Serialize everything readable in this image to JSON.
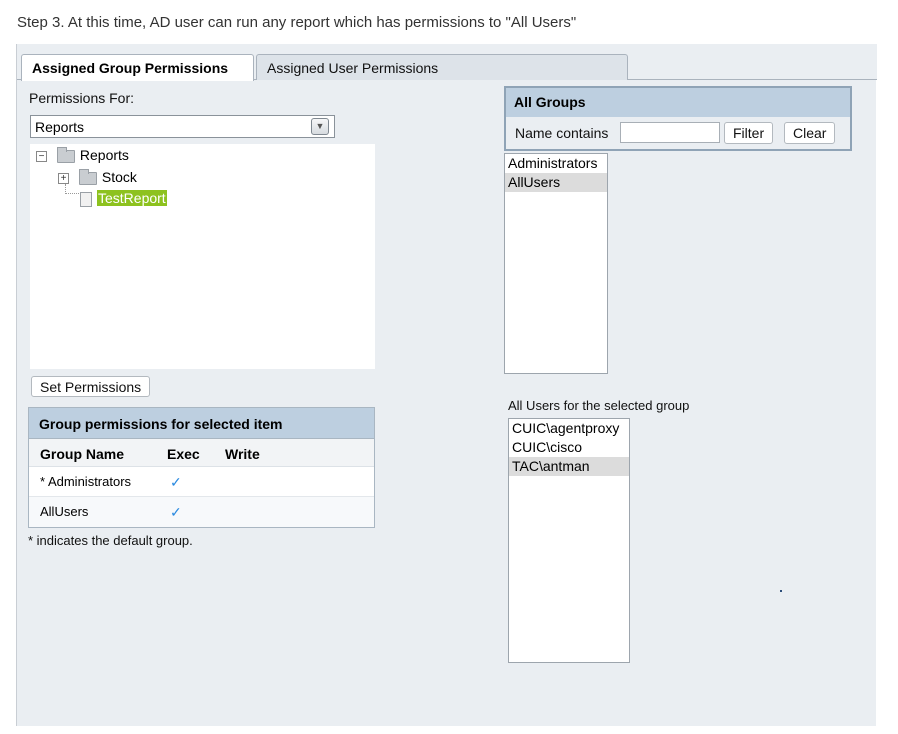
{
  "caption": "Step 3. At this time, AD user can run any report which has permissions to \"All Users\"",
  "tabs": [
    {
      "label": "Assigned Group Permissions",
      "active": true
    },
    {
      "label": "Assigned User Permissions",
      "active": false
    }
  ],
  "left": {
    "permissions_for_label": "Permissions For:",
    "select_value": "Reports",
    "tree": {
      "root": {
        "label": "Reports",
        "expander": "−",
        "icon": "folder-open-icon"
      },
      "children": [
        {
          "label": "Stock",
          "expander": "+",
          "icon": "folder-icon"
        },
        {
          "label": "TestReport",
          "icon": "report-icon",
          "selected": true
        }
      ]
    },
    "set_permissions_label": "Set Permissions",
    "group_table": {
      "title": "Group permissions for selected item",
      "columns": [
        "Group Name",
        "Exec",
        "Write"
      ],
      "rows": [
        {
          "group": "* Administrators",
          "exec": "✓",
          "write": ""
        },
        {
          "group": "AllUsers",
          "exec": "✓",
          "write": ""
        }
      ]
    },
    "footnote": "* indicates the default group."
  },
  "right": {
    "all_groups_title": "All Groups",
    "name_contains_label": "Name contains",
    "name_contains_value": "",
    "filter_label": "Filter",
    "clear_label": "Clear",
    "groups": [
      {
        "label": "Administrators",
        "selected": false
      },
      {
        "label": "AllUsers",
        "selected": true
      }
    ],
    "users_label": "All Users for the selected group",
    "users": [
      {
        "label": "CUIC\\agentproxy",
        "selected": false
      },
      {
        "label": "CUIC\\cisco",
        "selected": false
      },
      {
        "label": "TAC\\antman",
        "selected": true
      }
    ]
  },
  "colors": {
    "panel_bg": "#eaeef2",
    "header_blue": "#bdcfe0",
    "highlight_green": "#8dc21f",
    "check_blue": "#2a8ae0"
  }
}
